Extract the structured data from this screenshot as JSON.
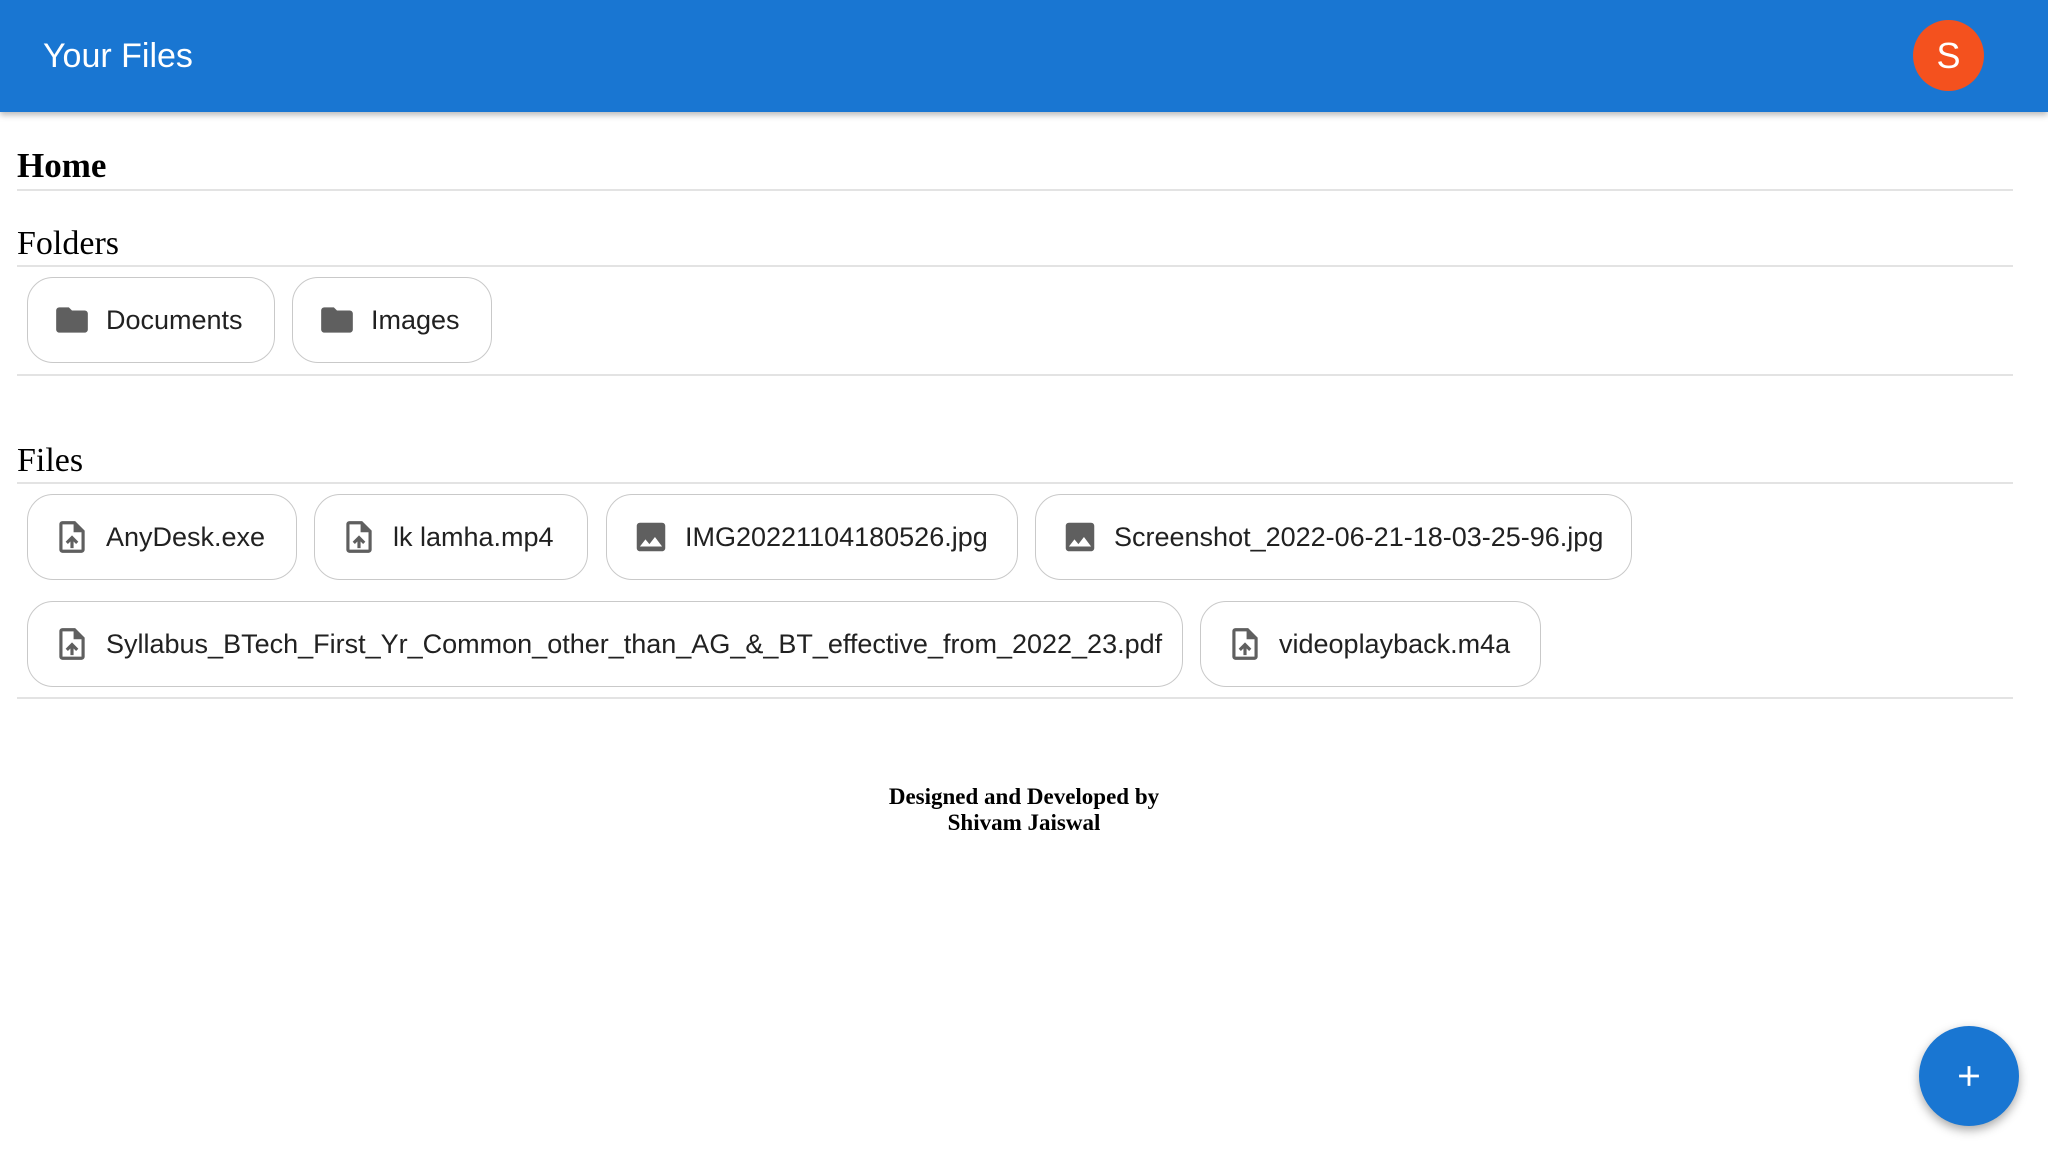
{
  "appbar": {
    "title": "Your Files",
    "avatar_letter": "S"
  },
  "breadcrumb": {
    "current": "Home"
  },
  "folders": {
    "heading": "Folders",
    "items": [
      {
        "name": "Documents",
        "icon": "folder-icon"
      },
      {
        "name": "Images",
        "icon": "folder-icon"
      }
    ]
  },
  "files": {
    "heading": "Files",
    "items": [
      {
        "name": "AnyDesk.exe",
        "icon": "file-upload-icon"
      },
      {
        "name": "lk lamha.mp4",
        "icon": "file-upload-icon"
      },
      {
        "name": "IMG20221104180526.jpg",
        "icon": "image-icon"
      },
      {
        "name": "Screenshot_2022-06-21-18-03-25-96.jpg",
        "icon": "image-icon"
      },
      {
        "name": "Syllabus_BTech_First_Yr_Common_other_than_AG_&_BT_effective_from_2022_23.pdf",
        "icon": "file-upload-icon"
      },
      {
        "name": "videoplayback.m4a",
        "icon": "file-upload-icon"
      }
    ]
  },
  "footer": {
    "line1": "Designed and Developed by",
    "line2": "Shivam Jaiswal"
  },
  "fab": {
    "icon": "add-icon"
  },
  "colors": {
    "appbar": "#1976d2",
    "avatar": "#f4511e",
    "fab": "#1976d2",
    "icon": "#5f5f5f"
  }
}
